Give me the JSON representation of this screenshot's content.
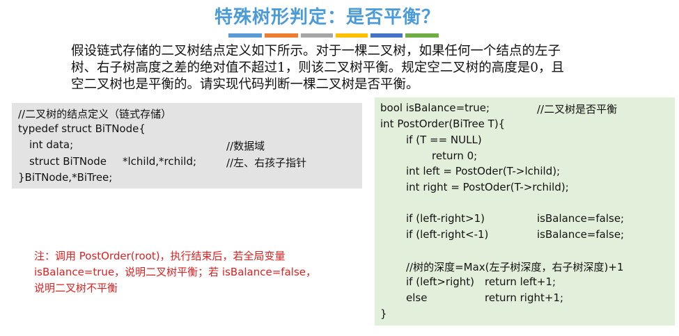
{
  "title": "特殊树形判定：是否平衡？",
  "color_bars": [
    "#5b9bd5",
    "#ed7d31",
    "#a5a5a5",
    "#ffc000",
    "#4472c4",
    "#70ad47"
  ],
  "intro": "假设链式存储的二叉树结点定义如下所示。对于一棵二叉树，如果任何一个结点的左子\n树、右子树高度之差的绝对值不超过1，则该二叉树平衡。规定空二叉树的高度是0，且\n空二叉树也是平衡的。请实现代码判断一棵二叉树是否平衡。",
  "node_def": {
    "comment": "//二叉树的结点定义（链式存储）",
    "typedef": "typedef struct BiTNode{",
    "data_decl": "int data;",
    "data_comment": "//数据域",
    "child_decl": "struct BiTNode",
    "child_vars": "*lchild,*rchild;",
    "child_comment": "//左、右孩子指针",
    "close": "}BiTNode,*BiTree;"
  },
  "post_order": {
    "global_decl": "bool isBalance=true;",
    "global_comment": "//二叉树是否平衡",
    "func_sig": "int PostOrder(BiTree T){",
    "if_null": "if (T == NULL)",
    "return_zero": "return 0;",
    "left_call": "int left = PostOder(T->lchild);",
    "right_call": "int right = PostOder(T->rchild);",
    "check1_cond": "if (left-right>1)",
    "check1_action": "isBalance=false;",
    "check2_cond": "if (left-right<-1)",
    "check2_action": "isBalance=false;",
    "depth_comment": "//树的深度=Max(左子树深度，右子树深度)+1",
    "if_cond": "if (left>right)",
    "if_return": "return left+1;",
    "else_kw": "else",
    "else_return": "return right+1;",
    "close": "}"
  },
  "note": "注：调用 PostOrder(root)，执行结束后，若全局变量\nisBalance=true，说明二叉树平衡；若 isBalance=false，\n说明二叉树不平衡"
}
